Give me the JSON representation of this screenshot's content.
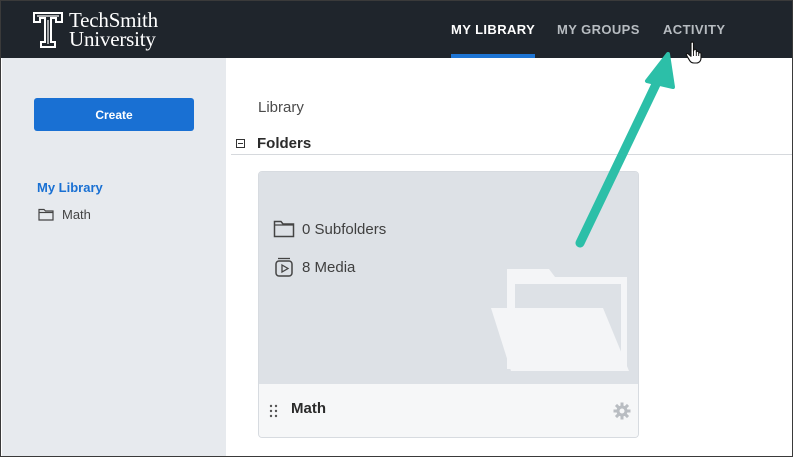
{
  "header": {
    "logo_line1": "TechSmith",
    "logo_line2": "University",
    "nav": [
      {
        "label": "MY LIBRARY",
        "active": true
      },
      {
        "label": "MY GROUPS",
        "active": false
      },
      {
        "label": "ACTIVITY",
        "active": false
      }
    ]
  },
  "sidebar": {
    "create_label": "Create",
    "library_label": "My Library",
    "items": [
      {
        "label": "Math",
        "icon": "folder-icon"
      }
    ]
  },
  "main": {
    "breadcrumb": "Library",
    "section_title": "Folders",
    "folder_card": {
      "subfolders": "0 Subfolders",
      "media": "8 Media",
      "name": "Math"
    }
  },
  "colors": {
    "topbar": "#1f252c",
    "accent": "#1970d3",
    "annotation_arrow": "#2cbfa8"
  }
}
